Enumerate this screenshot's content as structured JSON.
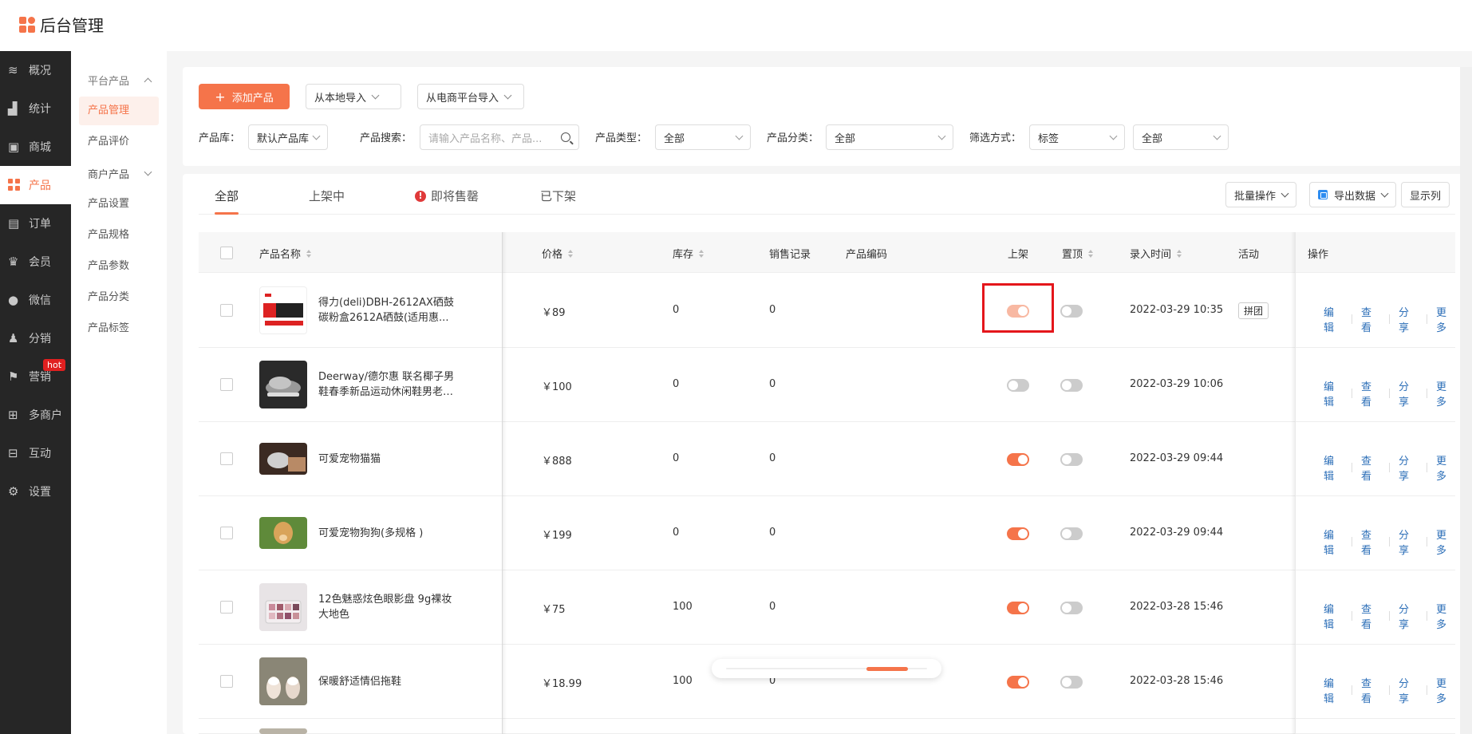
{
  "app": {
    "title": "后台管理"
  },
  "sidebar": {
    "items": [
      {
        "label": "概况",
        "icon": "layers-icon"
      },
      {
        "label": "统计",
        "icon": "chart-icon"
      },
      {
        "label": "商城",
        "icon": "shop-icon"
      },
      {
        "label": "产品",
        "icon": "grid-icon",
        "active": true
      },
      {
        "label": "订单",
        "icon": "order-icon"
      },
      {
        "label": "会员",
        "icon": "crown-icon"
      },
      {
        "label": "微信",
        "icon": "wechat-icon"
      },
      {
        "label": "分销",
        "icon": "distribution-icon"
      },
      {
        "label": "营销",
        "icon": "flag-icon",
        "badge": "hot"
      },
      {
        "label": "多商户",
        "icon": "merchant-icon"
      },
      {
        "label": "互动",
        "icon": "interact-icon"
      },
      {
        "label": "设置",
        "icon": "gear-icon"
      }
    ]
  },
  "submenu": {
    "group1": "平台产品",
    "items": [
      "产品管理",
      "产品评价"
    ],
    "group2": "商户产品",
    "items2": [
      "产品设置",
      "产品规格",
      "产品参数",
      "产品分类",
      "产品标签"
    ]
  },
  "filters": {
    "add_button": "添加产品",
    "import_local": "从本地导入",
    "import_ecommerce": "从电商平台导入",
    "library_label": "产品库：",
    "library_value": "默认产品库",
    "search_label": "产品搜索：",
    "search_placeholder": "请输入产品名称、产品...",
    "type_label": "产品类型：",
    "type_value": "全部",
    "category_label": "产品分类：",
    "category_value": "全部",
    "filter_label": "筛选方式：",
    "filter_mode": "标签",
    "filter_value": "全部"
  },
  "tabs": {
    "all": "全部",
    "on_shelf": "上架中",
    "selling_out": "即将售罄",
    "off_shelf": "已下架"
  },
  "toolbar": {
    "batch": "批量操作",
    "export": "导出数据",
    "columns": "显示列"
  },
  "columns": {
    "name": "产品名称",
    "price": "价格",
    "stock": "库存",
    "sales": "销售记录",
    "code": "产品编码",
    "on_shelf": "上架",
    "pin_top": "置顶",
    "entry_time": "录入时间",
    "activity": "活动",
    "actions": "操作"
  },
  "actions": {
    "edit": "编辑",
    "view": "查看",
    "share": "分享",
    "more": "更多"
  },
  "rows": [
    {
      "name": "得力(deli)DBH-2612AX硒鼓 碳粉盒2612A硒鼓(适用惠...",
      "price": "￥89",
      "stock": "0",
      "sales": "0",
      "code": "",
      "on_shelf": true,
      "pin_top": false,
      "time": "2022-03-29 10:35",
      "activity": "拼团"
    },
    {
      "name": "Deerway/德尔惠 联名椰子男鞋春季新品运动休闲鞋男老爹...",
      "price": "￥100",
      "stock": "0",
      "sales": "0",
      "code": "",
      "on_shelf": false,
      "pin_top": false,
      "time": "2022-03-29 10:06",
      "activity": ""
    },
    {
      "name": "可爱宠物猫猫",
      "price": "￥888",
      "stock": "0",
      "sales": "0",
      "code": "",
      "on_shelf": true,
      "pin_top": false,
      "time": "2022-03-29 09:44",
      "activity": ""
    },
    {
      "name": "可爱宠物狗狗(多规格 )",
      "price": "￥199",
      "stock": "0",
      "sales": "0",
      "code": "",
      "on_shelf": true,
      "pin_top": false,
      "time": "2022-03-29 09:44",
      "activity": ""
    },
    {
      "name": "12色魅惑炫色眼影盘 9g裸妆大地色",
      "price": "￥75",
      "stock": "100",
      "sales": "0",
      "code": "",
      "on_shelf": true,
      "pin_top": false,
      "time": "2022-03-28 15:46",
      "activity": ""
    },
    {
      "name": "保暖舒适情侣拖鞋",
      "price": "￥18.99",
      "stock": "100",
      "sales": "0",
      "code": "",
      "on_shelf": true,
      "pin_top": false,
      "time": "2022-03-28 15:46",
      "activity": ""
    }
  ]
}
